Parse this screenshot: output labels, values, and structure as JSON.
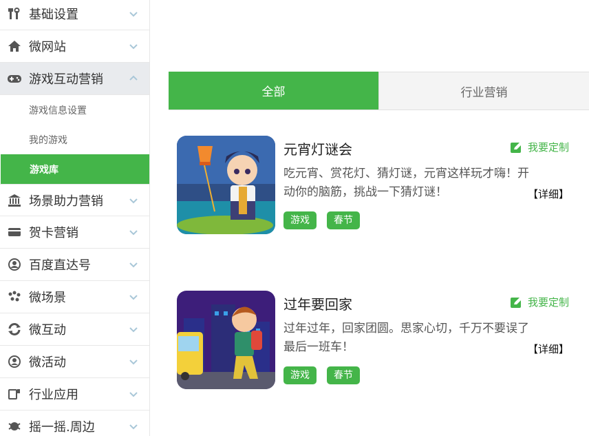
{
  "sidebar": {
    "items": [
      {
        "label": "基础设置",
        "icon": "tools-icon"
      },
      {
        "label": "微网站",
        "icon": "home-icon"
      },
      {
        "label": "游戏互动营销",
        "icon": "gamepad-icon"
      },
      {
        "label": "场景助力营销",
        "icon": "bank-icon"
      },
      {
        "label": "贺卡营销",
        "icon": "card-icon"
      },
      {
        "label": "百度直达号",
        "icon": "search-person-icon"
      },
      {
        "label": "微场景",
        "icon": "scenes-icon"
      },
      {
        "label": "微互动",
        "icon": "refresh-icon"
      },
      {
        "label": "微活动",
        "icon": "activity-icon"
      },
      {
        "label": "行业应用",
        "icon": "apps-icon"
      },
      {
        "label": "摇一摇.周边",
        "icon": "shake-icon"
      }
    ],
    "sub_items": [
      "游戏信息设置",
      "我的游戏",
      "游戏库"
    ]
  },
  "tabs": [
    "全部",
    "行业营销"
  ],
  "games": [
    {
      "title": "元宵灯谜会",
      "desc": "吃元宵、赏花灯、猜灯谜，元宵这样玩才嗨！开动你的脑筋，挑战一下猜灯谜！",
      "tags": [
        "游戏",
        "春节"
      ]
    },
    {
      "title": "过年要回家",
      "desc": "过年过年，回家团圆。思家心切，千万不要误了最后一班车！",
      "tags": [
        "游戏",
        "春节"
      ]
    }
  ],
  "labels": {
    "customize": "我要定制",
    "detail": "【详细】"
  },
  "colors": {
    "accent": "#44b549"
  }
}
